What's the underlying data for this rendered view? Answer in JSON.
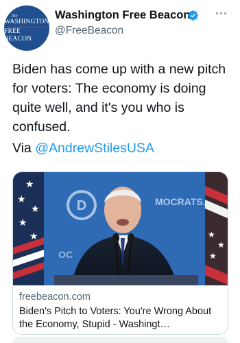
{
  "account": {
    "display_name": "Washington Free Beacon",
    "handle": "@FreeBeacon",
    "verified": true,
    "avatar_logo": {
      "the": "the",
      "line1": "WASHINGTON",
      "line2": "FREE BEACON"
    }
  },
  "tweet": {
    "text": "Biden has come up with a new pitch for voters: The economy is doing quite well, and it's you who is confused.",
    "via_prefix": "Via ",
    "mention": "@AndrewStilesUSA"
  },
  "card": {
    "domain": "freebeacon.com",
    "title": "Biden's Pitch to Voters: You're Wrong About the Economy, Stupid - Washingt…",
    "banner_text": "MOCRATS.C",
    "banner_left_text": "OC"
  },
  "colors": {
    "accent": "#1d9bf0",
    "secondary_text": "#536471",
    "avatar_bg": "#1f4f8f"
  }
}
